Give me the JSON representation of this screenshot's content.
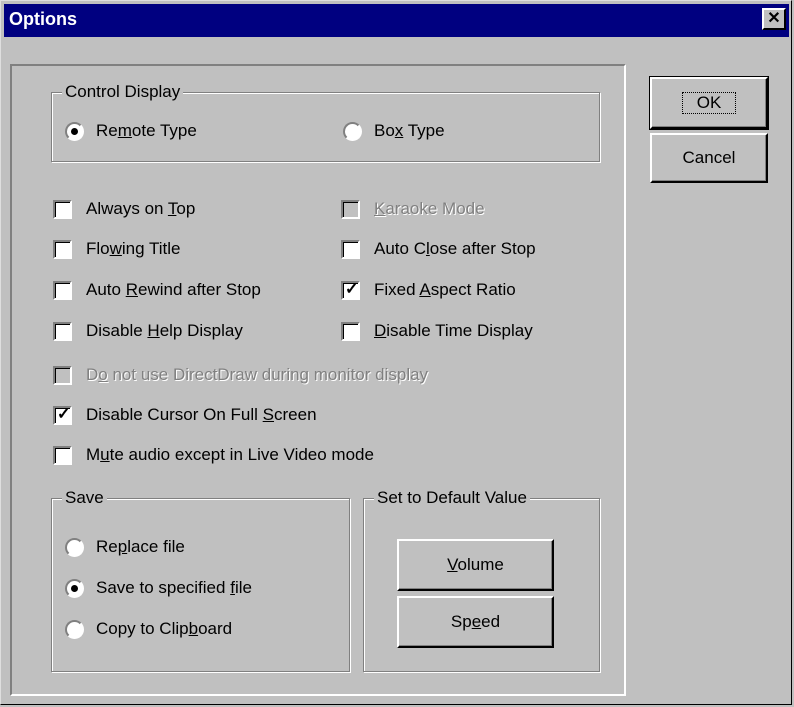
{
  "window": {
    "title": "Options",
    "close_label": "✕"
  },
  "buttons": {
    "ok": "OK",
    "cancel": "Cancel",
    "volume": "Volume",
    "speed": "Speed"
  },
  "control_display": {
    "title": "Control Display",
    "remote_type": "Remote Type",
    "box_type": "Box Type",
    "selected": "remote_type"
  },
  "options": {
    "always_on_top": {
      "label": "Always on Top",
      "checked": false,
      "enabled": true
    },
    "karaoke_mode": {
      "label": "Karaoke Mode",
      "checked": false,
      "enabled": false
    },
    "flowing_title": {
      "label": "Flowing Title",
      "checked": false,
      "enabled": true
    },
    "auto_close": {
      "label": "Auto Close after Stop",
      "checked": false,
      "enabled": true
    },
    "auto_rewind": {
      "label": "Auto Rewind after Stop",
      "checked": false,
      "enabled": true
    },
    "fixed_aspect": {
      "label": "Fixed Aspect Ratio",
      "checked": true,
      "enabled": true
    },
    "disable_help": {
      "label": "Disable Help Display",
      "checked": false,
      "enabled": true
    },
    "disable_time": {
      "label": "Disable Time Display",
      "checked": false,
      "enabled": true
    },
    "no_directdraw": {
      "label": "Do not use DirectDraw during monitor display",
      "checked": false,
      "enabled": false
    },
    "disable_cursor": {
      "label": "Disable Cursor On Full Screen",
      "checked": true,
      "enabled": true
    },
    "mute_audio": {
      "label": "Mute audio except in Live Video mode",
      "checked": false,
      "enabled": true
    }
  },
  "save": {
    "title": "Save",
    "replace_file": "Replace file",
    "save_specified": "Save to specified file",
    "copy_clipboard": "Copy to Clipboard",
    "selected": "save_specified"
  },
  "defaults": {
    "title": "Set to Default Value"
  },
  "colors": {
    "title_bar": "#000080",
    "face": "#c0c0c0"
  }
}
